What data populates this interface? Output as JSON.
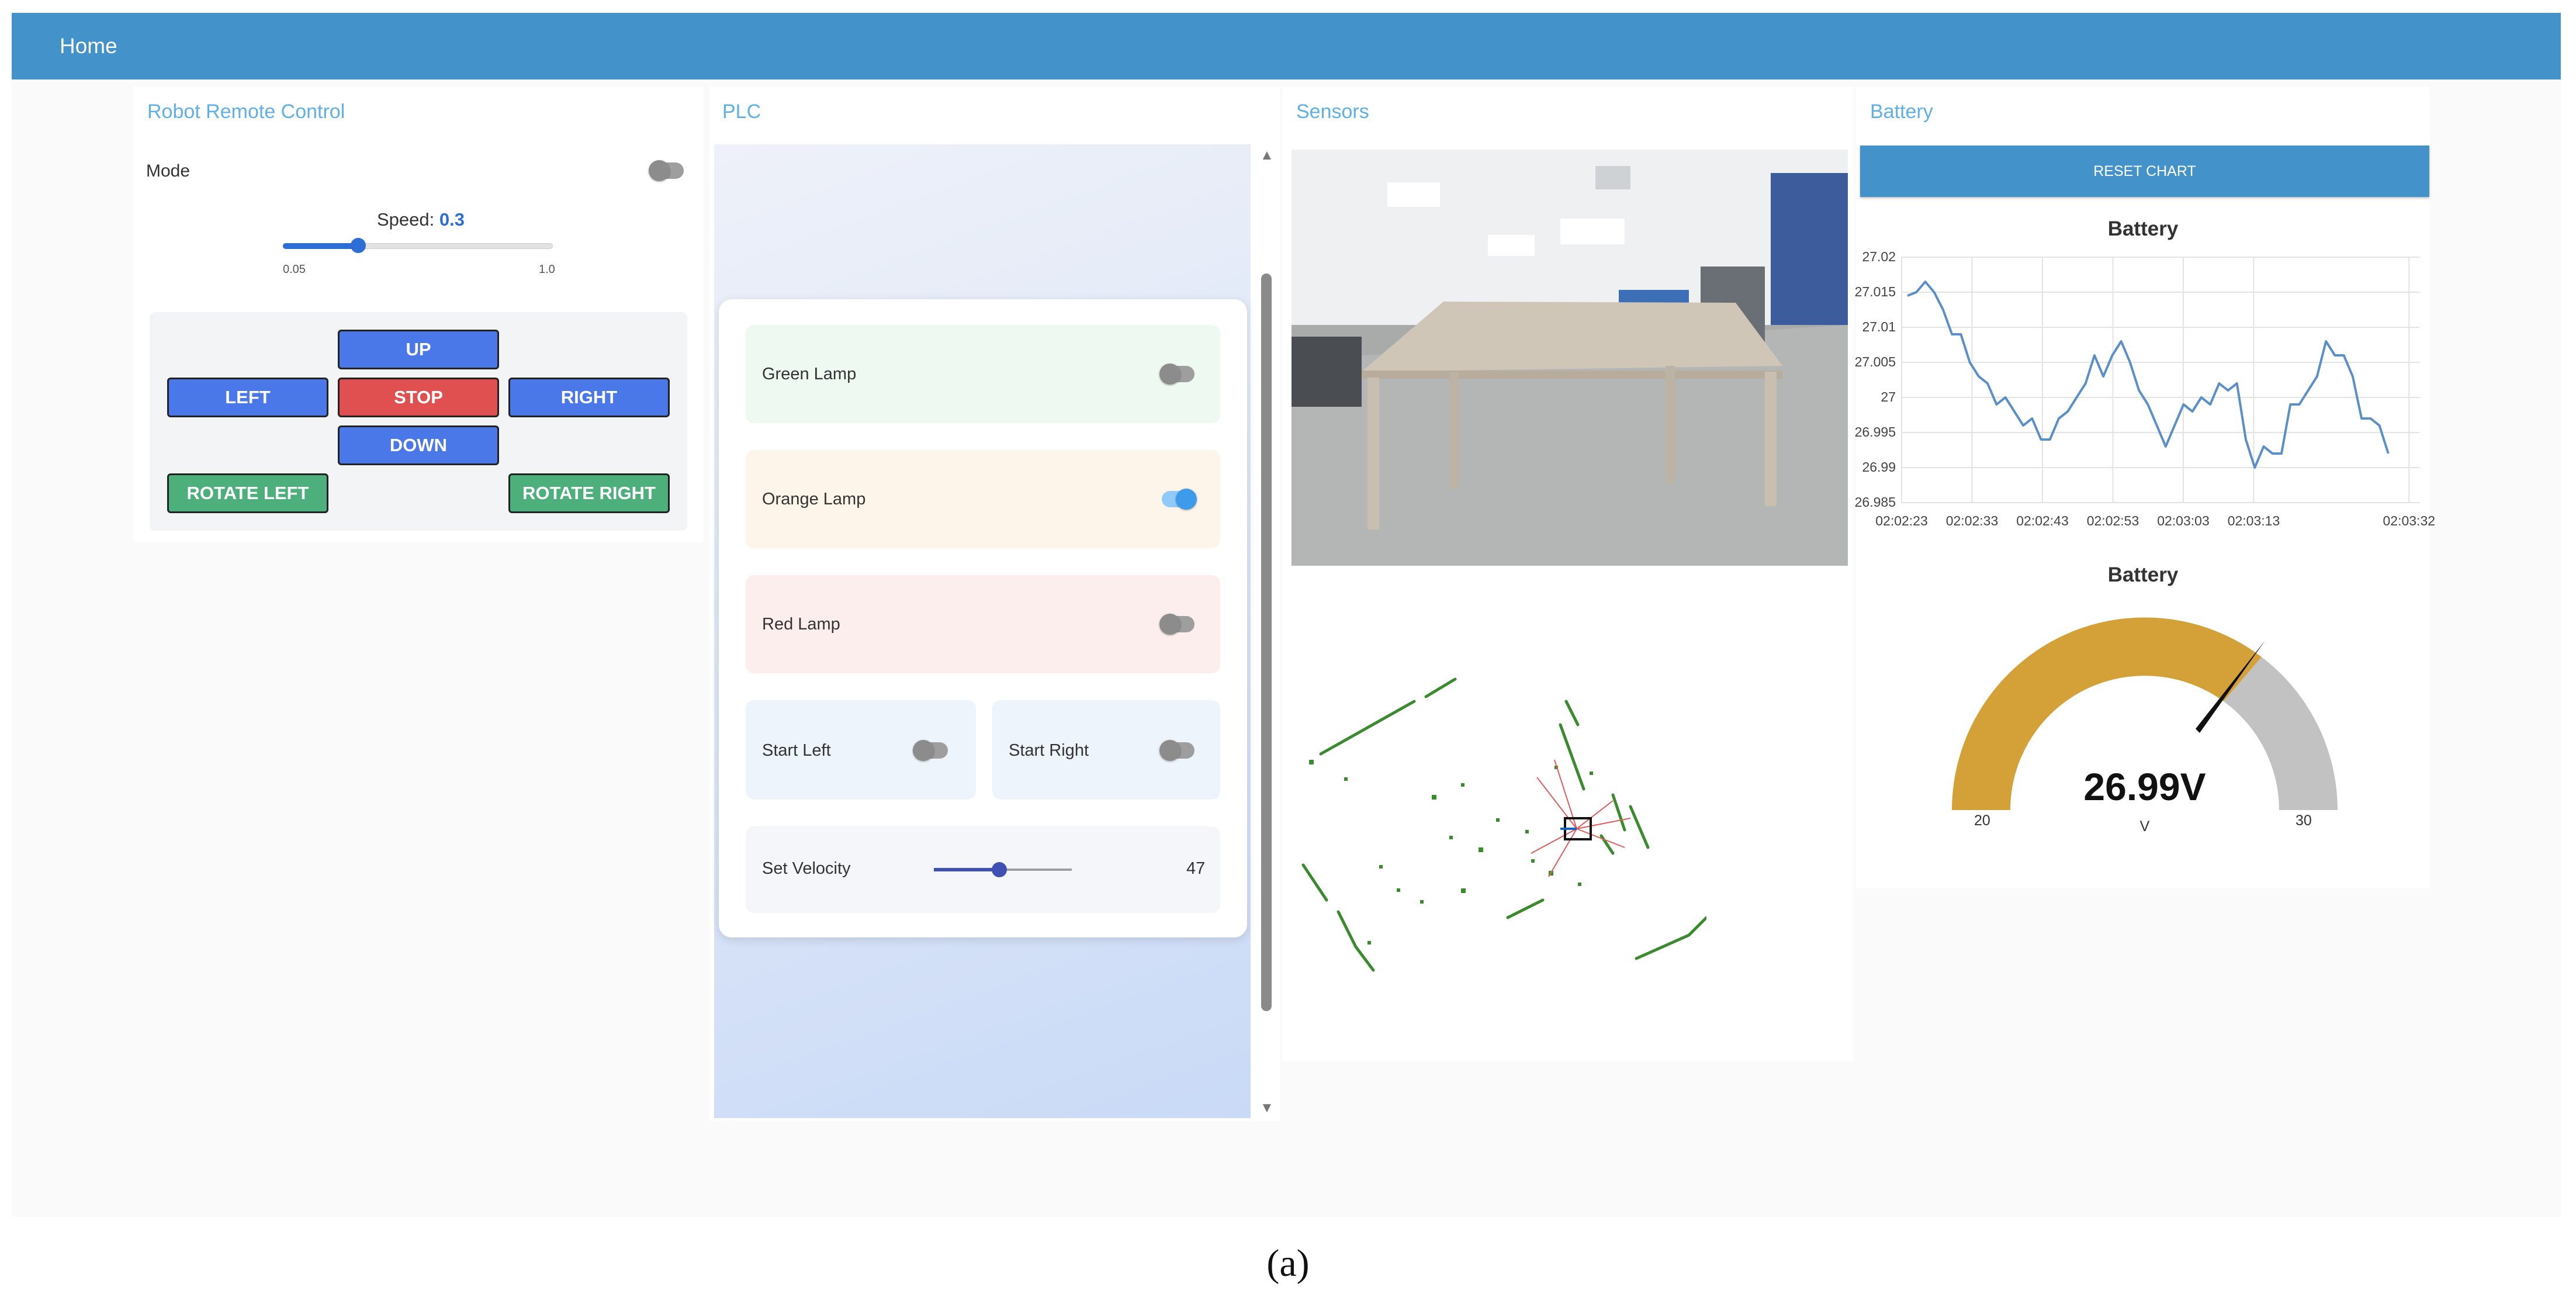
{
  "nav": {
    "home_label": "Home"
  },
  "robot": {
    "title": "Robot Remote Control",
    "mode_label": "Mode",
    "mode_on": false,
    "speed_label": "Speed:",
    "speed_value": "0.3",
    "speed_min_label": "0.05",
    "speed_max_label": "1.0",
    "buttons": {
      "up": "UP",
      "left": "LEFT",
      "stop": "STOP",
      "right": "RIGHT",
      "down": "DOWN",
      "rotate_left": "ROTATE LEFT",
      "rotate_right": "ROTATE RIGHT"
    }
  },
  "plc": {
    "title": "PLC",
    "green_lamp": {
      "label": "Green Lamp",
      "on": false
    },
    "orange_lamp": {
      "label": "Orange Lamp",
      "on": true
    },
    "red_lamp": {
      "label": "Red Lamp",
      "on": false
    },
    "start_left": {
      "label": "Start Left",
      "on": false
    },
    "start_right": {
      "label": "Start Right",
      "on": false
    },
    "velocity": {
      "label": "Set Velocity",
      "value": "47"
    }
  },
  "sensors": {
    "title": "Sensors"
  },
  "battery": {
    "title": "Battery",
    "reset_label": "RESET CHART",
    "chart_title": "Battery",
    "gauge_title": "Battery",
    "gauge_value": "26.99V",
    "gauge_unit": "V",
    "gauge_min": "20",
    "gauge_max": "30"
  },
  "chart_data": {
    "type": "line",
    "title": "Battery",
    "xlabel": "",
    "ylabel": "",
    "ylim": [
      26.985,
      27.02
    ],
    "x_tick_labels": [
      "02:02:23",
      "02:02:33",
      "02:02:43",
      "02:02:53",
      "02:03:03",
      "02:03:13",
      "02:03:32"
    ],
    "y_tick_labels": [
      "27.02",
      "27.015",
      "27.01",
      "27.005",
      "27",
      "26.995",
      "26.99",
      "26.985"
    ],
    "grid": true,
    "series": [
      {
        "values": [
          27.0145,
          27.015,
          27.0165,
          27.015,
          27.0125,
          27.009,
          27.009,
          27.005,
          27.003,
          27.002,
          26.999,
          27.0,
          26.998,
          26.996,
          26.997,
          26.994,
          26.994,
          26.997,
          26.998,
          27.0,
          27.002,
          27.006,
          27.003,
          27.006,
          27.008,
          27.005,
          27.001,
          26.999,
          26.996,
          26.993,
          26.996,
          26.999,
          26.998,
          27.0,
          26.999,
          27.002,
          27.001,
          27.002,
          26.994,
          26.99,
          26.993,
          26.992,
          26.992,
          26.999,
          26.999,
          27.001,
          27.003,
          27.008,
          27.006,
          27.006,
          27.003,
          26.997,
          26.997,
          26.996,
          26.992
        ]
      }
    ]
  },
  "figure_caption": "(a)"
}
